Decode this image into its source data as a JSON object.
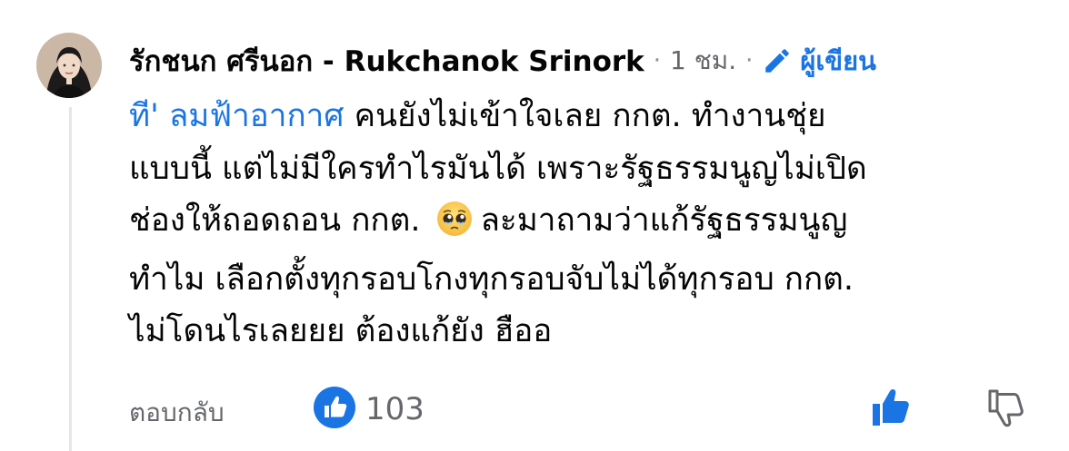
{
  "comment": {
    "author": "รักชนก ศรีนอก - Rukchanok Srinork",
    "separator": "·",
    "time": "1 ชม.",
    "author_badge": "ผู้เขียน",
    "mention": "ที' ลมฟ้าอากาศ",
    "lines": [
      " คนยังไม่เข้าใจเลย กกต. ทำงานชุ่ย",
      "แบบนี้ แต่ไม่มีใครทำไรมันได้ เพราะรัฐธรรมนูญไม่เปิด",
      "ช่องให้ถอดถอน กกต.",
      "ละมาถามว่าแก้รัฐธรรมนูญ",
      "ทำไม เลือกตั้งทุกรอบโกงทุกรอบจับไม่ได้ทุกรอบ กกต.",
      "ไม่โดนไรเลยยย ต้องแก้ยัง ฮืออ"
    ],
    "emoji": "pleading-face"
  },
  "footer": {
    "reply_label": "ตอบกลับ",
    "like_count": "103"
  },
  "colors": {
    "accent": "#1b74e4",
    "secondary_text": "#65676b",
    "primary_text": "#050505",
    "thread_line": "#e4e6eb"
  },
  "icons": {
    "avatar": "user-avatar",
    "badge": "pencil-icon",
    "reaction": "like-reaction-icon",
    "like": "thumbs-up-icon",
    "dislike": "thumbs-down-icon"
  }
}
